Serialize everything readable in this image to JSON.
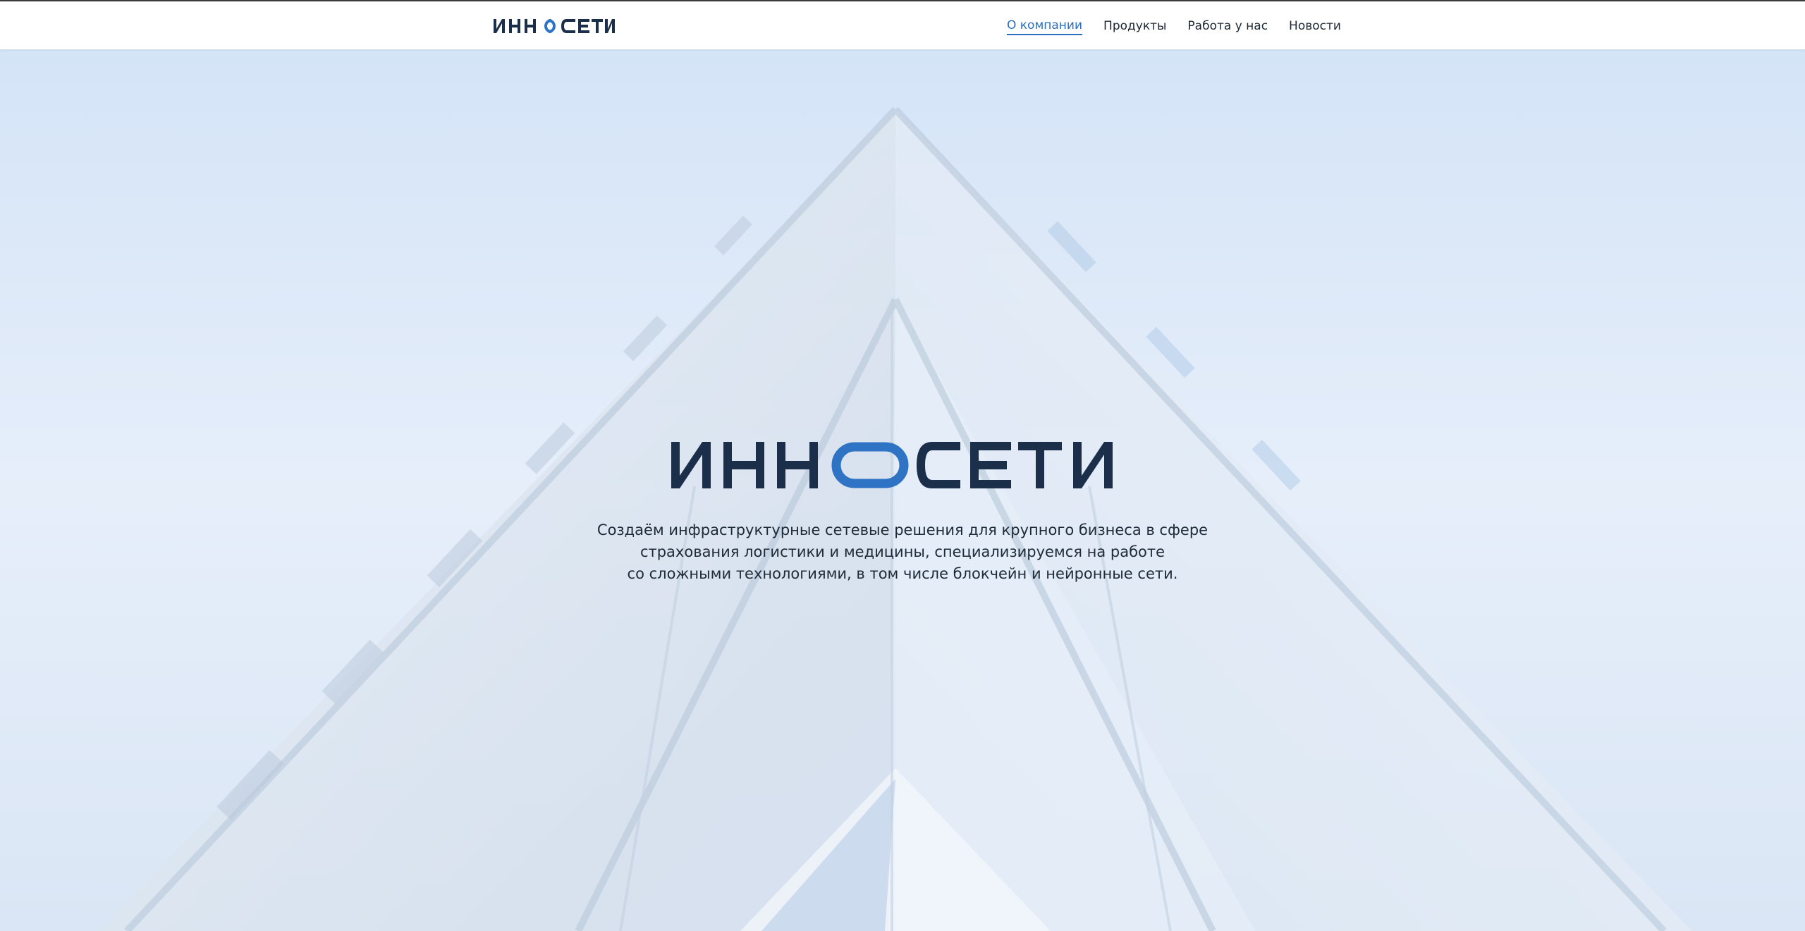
{
  "header": {
    "logo_alt": "ИННОСЕТИ",
    "nav": [
      {
        "label": "О компании",
        "active": true
      },
      {
        "label": "Продукты",
        "active": false
      },
      {
        "label": "Работа у нас",
        "active": false
      },
      {
        "label": "Новости",
        "active": false
      }
    ]
  },
  "hero": {
    "logo_text_left": "ИНН",
    "logo_text_right": "СЕТИ",
    "tagline_lines": [
      "Создаём инфраструктурные сетевые решения для крупного бизнеса в сфере",
      "страхования логистики и медицины, специализируемся на работе",
      "со сложными технологиями, в том числе блокчейн и нейронные сети."
    ]
  },
  "colors": {
    "brand_dark": "#1b2e4a",
    "brand_blue": "#2f74c4",
    "nav_active": "#2a6fc0"
  }
}
